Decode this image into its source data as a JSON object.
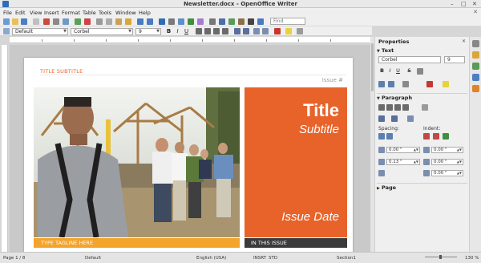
{
  "window": {
    "title": "Newsletter.docx - OpenOffice Writer",
    "min": "–",
    "max": "□",
    "close": "✕"
  },
  "menubar": {
    "items": [
      "File",
      "Edit",
      "View",
      "Insert",
      "Format",
      "Table",
      "Tools",
      "Window",
      "Help"
    ],
    "close": "✕"
  },
  "toolbar": {
    "find_placeholder": "Find"
  },
  "formatting": {
    "paragraph_style": "Default",
    "font_name": "Corbel",
    "font_size": "9",
    "bold": "B",
    "italic": "I",
    "underline": "U"
  },
  "document": {
    "title_subtitle": "TITLE SUBTITLE",
    "issue_number": "Issue #",
    "title": "Title",
    "subtitle": "Subtitle",
    "issue_date": "Issue Date",
    "tagline": "TYPE TAGLINE HERE",
    "in_this_issue": "IN THIS ISSUE"
  },
  "sidebar": {
    "header": "Properties",
    "close": "✕",
    "text_section": {
      "title": "Text",
      "font_name": "Corbel",
      "font_size": "9",
      "bold": "B",
      "italic": "I",
      "underline": "U",
      "strike": "S"
    },
    "paragraph_section": {
      "title": "Paragraph",
      "spacing_label": "Spacing:",
      "indent_label": "Indent:",
      "spacing_above": "0.00 \"",
      "spacing_below": "0.13 \"",
      "indent_before": "0.00 \"",
      "indent_after": "0.00 \"",
      "indent_first": "0.00 \""
    },
    "page_section": {
      "title": "Page"
    }
  },
  "statusbar": {
    "page": "Page 1 / 8",
    "style": "Default",
    "language": "English (USA)",
    "insert_mode": "INSRT",
    "selection_mode": "STD",
    "section": "Section1",
    "zoom": "130 %"
  },
  "colors": {
    "accent_orange": "#e8632a",
    "tagline_orange": "#f4a32b",
    "dark_band": "#3b3b3b"
  }
}
